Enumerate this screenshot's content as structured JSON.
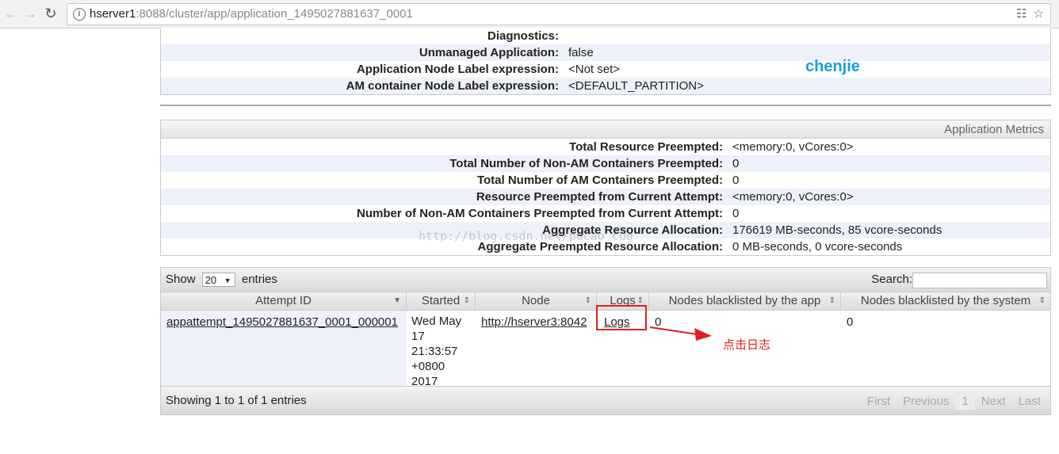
{
  "browser": {
    "url_host": "hserver1",
    "url_rest": ":8088/cluster/app/application_1495027881637_0001"
  },
  "overview": {
    "rows": [
      {
        "label": "Diagnostics:",
        "value": ""
      },
      {
        "label": "Unmanaged Application:",
        "value": "false"
      },
      {
        "label": "Application Node Label expression:",
        "value": "<Not set>"
      },
      {
        "label": "AM container Node Label expression:",
        "value": "<DEFAULT_PARTITION>"
      }
    ]
  },
  "watermark_name": "chenjie",
  "metrics": {
    "title": "Application Metrics",
    "rows": [
      {
        "label": "Total Resource Preempted:",
        "value": "<memory:0, vCores:0>"
      },
      {
        "label": "Total Number of Non-AM Containers Preempted:",
        "value": "0"
      },
      {
        "label": "Total Number of AM Containers Preempted:",
        "value": "0"
      },
      {
        "label": "Resource Preempted from Current Attempt:",
        "value": "<memory:0, vCores:0>"
      },
      {
        "label": "Number of Non-AM Containers Preempted from Current Attempt:",
        "value": "0"
      },
      {
        "label": "Aggregate Resource Allocation:",
        "value": "176619 MB-seconds, 85 vcore-seconds"
      },
      {
        "label": "Aggregate Preempted Resource Allocation:",
        "value": "0 MB-seconds, 0 vcore-seconds"
      }
    ],
    "watermark_url": "http://blog.csdn.net/pucao_cug"
  },
  "attempts": {
    "show_label": "Show",
    "page_size": "20",
    "entries_label": "entries",
    "search_label": "Search:",
    "columns": [
      "Attempt ID",
      "Started",
      "Node",
      "Logs",
      "Nodes blacklisted by the app",
      "Nodes blacklisted by the system"
    ],
    "rows": [
      {
        "attempt_id": "appattempt_1495027881637_0001_000001",
        "started_lines": [
          "Wed May",
          "17",
          "21:33:57",
          "+0800",
          "2017"
        ],
        "node": "http://hserver3:8042",
        "logs": "Logs",
        "blacklisted_app": "0",
        "blacklisted_system": "0"
      }
    ],
    "info": "Showing 1 to 1 of 1 entries",
    "pager": {
      "first": "First",
      "previous": "Previous",
      "page": "1",
      "next": "Next",
      "last": "Last"
    }
  },
  "annotation": "点击日志",
  "colors": {
    "annotation_red": "#e02020",
    "watermark_blue": "#1a9de0",
    "alt_row": "#eef0fa"
  }
}
